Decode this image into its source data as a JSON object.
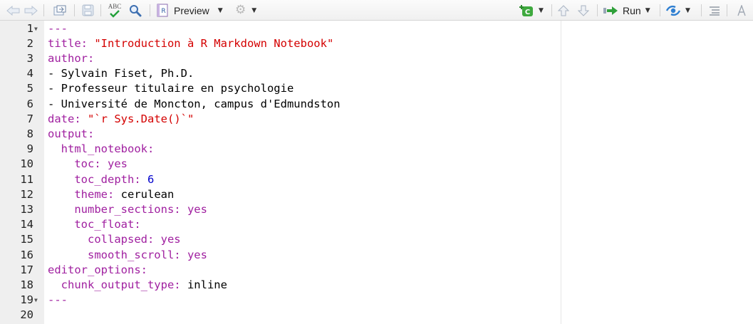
{
  "toolbar": {
    "icons": [
      "back-arrow-icon",
      "forward-arrow-icon",
      "show-in-window-icon",
      "save-icon",
      "spellcheck-icon",
      "find-replace-icon",
      "r-notebook-icon",
      "gear-icon",
      "insert-chunk-icon",
      "up-arrow-icon",
      "down-arrow-icon",
      "run-icon",
      "publish-icon",
      "outline-icon",
      "format-icon"
    ],
    "spellcheck_text": "ABC",
    "notebook_letter": "R",
    "preview_label": "Preview",
    "run_label": "Run",
    "chunk_letter": "C"
  },
  "colors": {
    "yaml_key": "#a020a0",
    "string": "#d40000",
    "number": "#0000cc",
    "plain": "#000000",
    "gutter_bg": "#efefef"
  },
  "editor": {
    "lines": [
      {
        "n": "1",
        "fold": true,
        "tokens": [
          {
            "t": "---",
            "c": "k"
          }
        ]
      },
      {
        "n": "2",
        "tokens": [
          {
            "t": "title: ",
            "c": "k"
          },
          {
            "t": "\"Introduction à R Markdown Notebook\"",
            "c": "s"
          }
        ]
      },
      {
        "n": "3",
        "tokens": [
          {
            "t": "author:",
            "c": "k"
          }
        ]
      },
      {
        "n": "4",
        "tokens": [
          {
            "t": "- Sylvain Fiset, Ph.D.",
            "c": "t"
          }
        ]
      },
      {
        "n": "5",
        "tokens": [
          {
            "t": "- Professeur titulaire en psychologie",
            "c": "t"
          }
        ]
      },
      {
        "n": "6",
        "tokens": [
          {
            "t": "- Université de Moncton, campus d'Edmundston",
            "c": "t"
          }
        ]
      },
      {
        "n": "7",
        "tokens": [
          {
            "t": "date: ",
            "c": "k"
          },
          {
            "t": "\"`r Sys.Date()`\"",
            "c": "s"
          }
        ]
      },
      {
        "n": "8",
        "tokens": [
          {
            "t": "output:",
            "c": "k"
          }
        ]
      },
      {
        "n": "9",
        "tokens": [
          {
            "t": "  html_notebook:",
            "c": "k"
          }
        ]
      },
      {
        "n": "10",
        "tokens": [
          {
            "t": "    toc: yes",
            "c": "k"
          }
        ]
      },
      {
        "n": "11",
        "tokens": [
          {
            "t": "    toc_depth: ",
            "c": "k"
          },
          {
            "t": "6",
            "c": "n"
          }
        ]
      },
      {
        "n": "12",
        "tokens": [
          {
            "t": "    theme: ",
            "c": "k"
          },
          {
            "t": "cerulean",
            "c": "t"
          }
        ]
      },
      {
        "n": "13",
        "tokens": [
          {
            "t": "    number_sections: yes",
            "c": "k"
          }
        ]
      },
      {
        "n": "14",
        "tokens": [
          {
            "t": "    toc_float:",
            "c": "k"
          }
        ]
      },
      {
        "n": "15",
        "tokens": [
          {
            "t": "      collapsed: yes",
            "c": "k"
          }
        ]
      },
      {
        "n": "16",
        "tokens": [
          {
            "t": "      smooth_scroll: yes",
            "c": "k"
          }
        ]
      },
      {
        "n": "17",
        "tokens": [
          {
            "t": "editor_options:",
            "c": "k"
          }
        ]
      },
      {
        "n": "18",
        "tokens": [
          {
            "t": "  chunk_output_type: ",
            "c": "k"
          },
          {
            "t": "inline",
            "c": "t"
          }
        ]
      },
      {
        "n": "19",
        "fold": true,
        "tokens": [
          {
            "t": "---",
            "c": "k"
          }
        ]
      },
      {
        "n": "20",
        "tokens": []
      }
    ]
  }
}
